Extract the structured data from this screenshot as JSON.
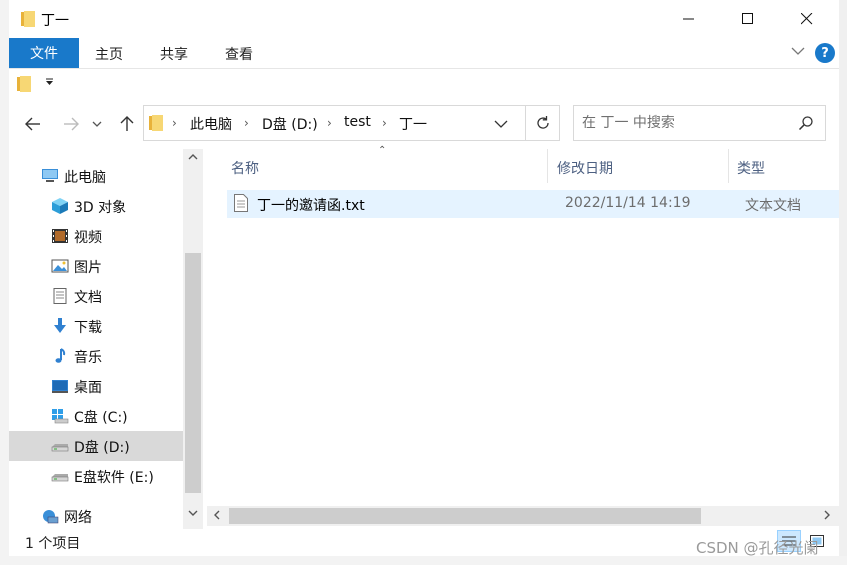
{
  "window": {
    "title": "丁一",
    "min_glyph": "—",
    "max_glyph": "☐",
    "close_glyph": "✕"
  },
  "ribbon": {
    "tabs": [
      "文件",
      "主页",
      "共享",
      "查看"
    ],
    "help_label": "?"
  },
  "nav": {
    "breadcrumbs": [
      "此电脑",
      "D盘 (D:)",
      "test",
      "丁一"
    ],
    "search_placeholder": "在 丁一 中搜索"
  },
  "sidebar": {
    "items": [
      {
        "label": "此电脑",
        "icon": "computer-icon"
      },
      {
        "label": "3D 对象",
        "icon": "cube-3d-icon"
      },
      {
        "label": "视频",
        "icon": "video-icon"
      },
      {
        "label": "图片",
        "icon": "picture-icon"
      },
      {
        "label": "文档",
        "icon": "document-icon"
      },
      {
        "label": "下载",
        "icon": "download-icon"
      },
      {
        "label": "音乐",
        "icon": "music-icon"
      },
      {
        "label": "桌面",
        "icon": "desktop-icon"
      },
      {
        "label": "C盘 (C:)",
        "icon": "windows-drive-icon"
      },
      {
        "label": "D盘 (D:)",
        "icon": "drive-icon",
        "selected": true
      },
      {
        "label": "E盘软件 (E:)",
        "icon": "drive-icon"
      },
      {
        "label": "网络",
        "icon": "network-icon"
      }
    ]
  },
  "columns": [
    "名称",
    "修改日期",
    "类型"
  ],
  "files": [
    {
      "name": "丁一的邀请函.txt",
      "modified": "2022/11/14 14:19",
      "type": "文本文档",
      "icon": "text-file-icon"
    }
  ],
  "status": {
    "count_text": "1 个项目"
  },
  "watermark": "CSDN @孔径光阑",
  "colors": {
    "accent": "#1979ca",
    "selected_row": "#e5f3ff",
    "selected_nav": "#d9d9d9"
  }
}
